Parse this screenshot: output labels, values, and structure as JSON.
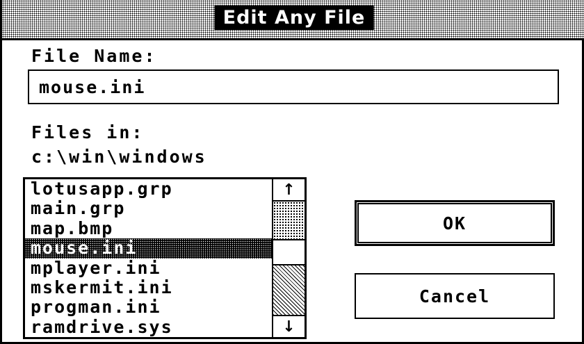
{
  "dialog": {
    "title": "Edit Any File",
    "file_name_label": "File Name:",
    "file_name_value": "mouse.ini",
    "files_in_label": "Files in:",
    "directory": "c:\\win\\windows",
    "files": [
      {
        "name": "lotusapp.grp",
        "selected": false
      },
      {
        "name": "main.grp",
        "selected": false
      },
      {
        "name": "map.bmp",
        "selected": false
      },
      {
        "name": "mouse.ini",
        "selected": true
      },
      {
        "name": "mplayer.ini",
        "selected": false
      },
      {
        "name": "mskermit.ini",
        "selected": false
      },
      {
        "name": "progman.ini",
        "selected": false
      },
      {
        "name": "ramdrive.sys",
        "selected": false
      }
    ],
    "ok_label": "OK",
    "cancel_label": "Cancel",
    "icons": {
      "scroll_up": "↑",
      "scroll_down": "↓"
    }
  }
}
